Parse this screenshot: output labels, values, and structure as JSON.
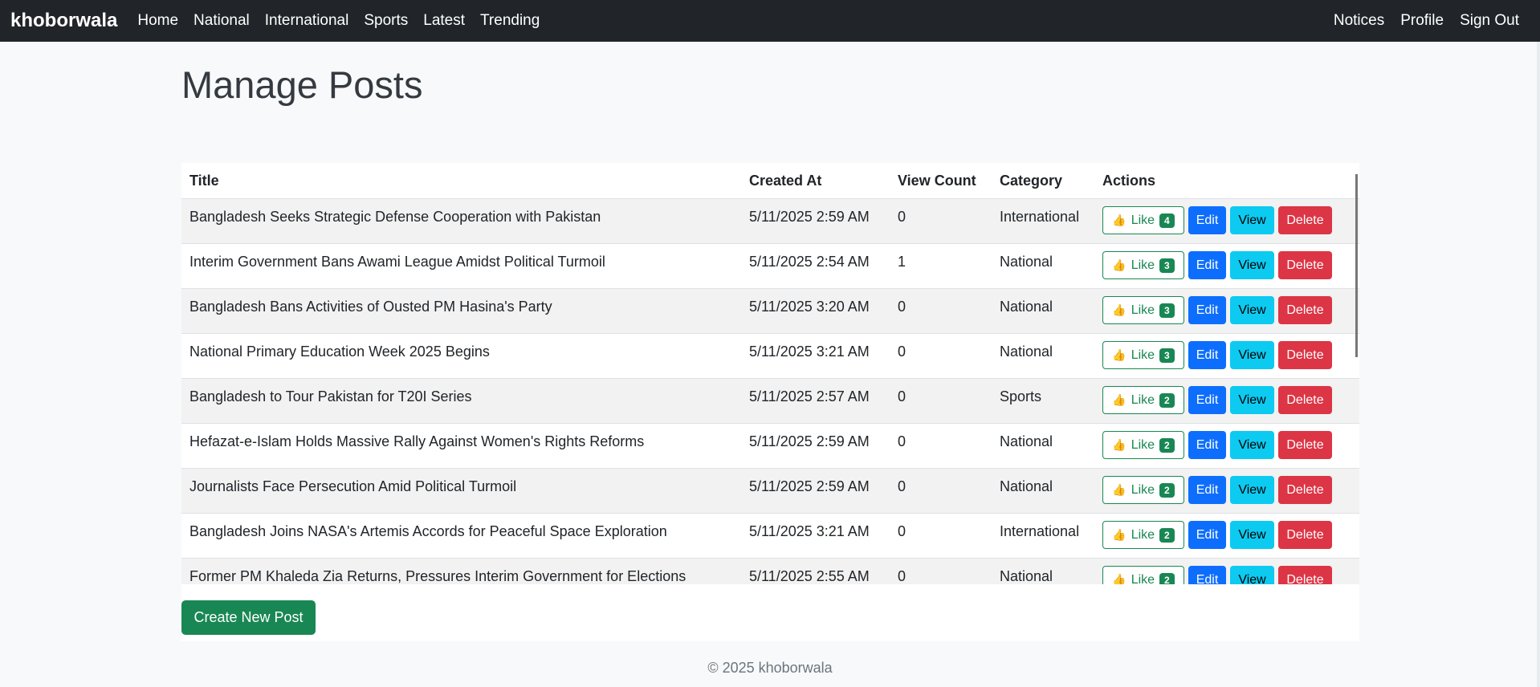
{
  "nav": {
    "brand": "khoborwala",
    "left_links": [
      "Home",
      "National",
      "International",
      "Sports",
      "Latest",
      "Trending"
    ],
    "right_links": [
      "Notices",
      "Profile",
      "Sign Out"
    ]
  },
  "page": {
    "title": "Manage Posts"
  },
  "table": {
    "headers": [
      "Title",
      "Created At",
      "View Count",
      "Category",
      "Actions"
    ],
    "rows": [
      {
        "title": "Bangladesh Seeks Strategic Defense Cooperation with Pakistan",
        "created": "5/11/2025 2:59 AM",
        "views": "0",
        "category": "International",
        "likes": "4"
      },
      {
        "title": "Interim Government Bans Awami League Amidst Political Turmoil",
        "created": "5/11/2025 2:54 AM",
        "views": "1",
        "category": "National",
        "likes": "3"
      },
      {
        "title": "Bangladesh Bans Activities of Ousted PM Hasina's Party",
        "created": "5/11/2025 3:20 AM",
        "views": "0",
        "category": "National",
        "likes": "3"
      },
      {
        "title": "National Primary Education Week 2025 Begins",
        "created": "5/11/2025 3:21 AM",
        "views": "0",
        "category": "National",
        "likes": "3"
      },
      {
        "title": "Bangladesh to Tour Pakistan for T20I Series",
        "created": "5/11/2025 2:57 AM",
        "views": "0",
        "category": "Sports",
        "likes": "2"
      },
      {
        "title": "Hefazat-e-Islam Holds Massive Rally Against Women's Rights Reforms",
        "created": "5/11/2025 2:59 AM",
        "views": "0",
        "category": "National",
        "likes": "2"
      },
      {
        "title": "Journalists Face Persecution Amid Political Turmoil",
        "created": "5/11/2025 2:59 AM",
        "views": "0",
        "category": "National",
        "likes": "2"
      },
      {
        "title": "Bangladesh Joins NASA's Artemis Accords for Peaceful Space Exploration",
        "created": "5/11/2025 3:21 AM",
        "views": "0",
        "category": "International",
        "likes": "2"
      },
      {
        "title": "Former PM Khaleda Zia Returns, Pressures Interim Government for Elections",
        "created": "5/11/2025 2:55 AM",
        "views": "0",
        "category": "National",
        "likes": "2"
      }
    ]
  },
  "actions": {
    "like": "Like",
    "edit": "Edit",
    "view": "View",
    "delete": "Delete",
    "like_icon": "thumbs-up-icon"
  },
  "create_button": "Create New Post",
  "footer": "© 2025 khoborwala",
  "colors": {
    "navbar": "#212529",
    "success": "#198754",
    "primary": "#0d6efd",
    "info": "#0dcaf0",
    "danger": "#dc3545"
  }
}
